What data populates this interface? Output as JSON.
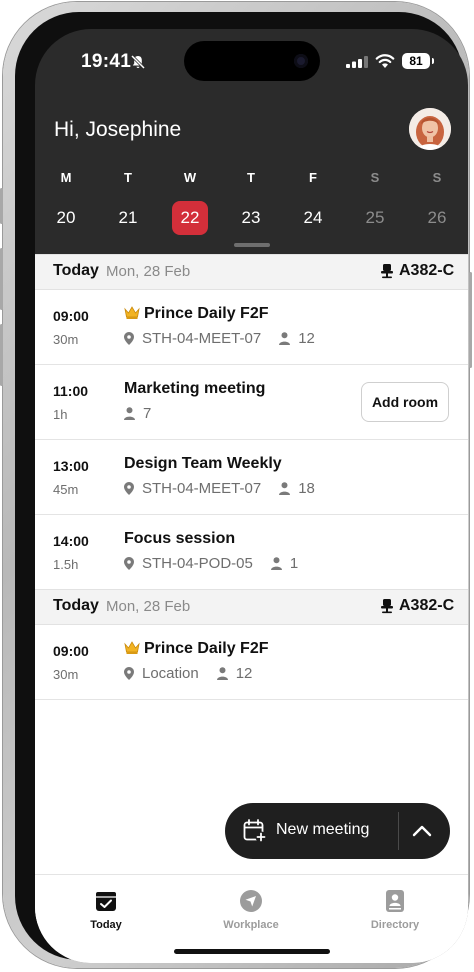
{
  "status_bar": {
    "time": "19:41",
    "battery": "81",
    "icons": [
      "bell-slash-icon",
      "signal-icon",
      "wifi-icon",
      "battery-icon"
    ]
  },
  "header": {
    "greeting": "Hi, Josephine",
    "avatar_icon": "avatar"
  },
  "week": [
    {
      "dow": "M",
      "num": "20",
      "state": "normal"
    },
    {
      "dow": "T",
      "num": "21",
      "state": "normal"
    },
    {
      "dow": "W",
      "num": "22",
      "state": "selected"
    },
    {
      "dow": "T",
      "num": "23",
      "state": "normal"
    },
    {
      "dow": "F",
      "num": "24",
      "state": "normal"
    },
    {
      "dow": "S",
      "num": "25",
      "state": "dim"
    },
    {
      "dow": "S",
      "num": "26",
      "state": "dim"
    }
  ],
  "sections": [
    {
      "label": "Today",
      "date": "Mon, 28 Feb",
      "desk": "A382-C",
      "items": [
        {
          "time": "09:00",
          "duration": "30m",
          "title": "Prince Daily F2F",
          "crown": true,
          "location": "STH-04-MEET-07",
          "attendees": "12"
        },
        {
          "time": "11:00",
          "duration": "1h",
          "title": "Marketing meeting",
          "crown": false,
          "location": "",
          "attendees": "7",
          "action": "Add room"
        },
        {
          "time": "13:00",
          "duration": "45m",
          "title": "Design Team Weekly",
          "crown": false,
          "location": "STH-04-MEET-07",
          "attendees": "18"
        },
        {
          "time": "14:00",
          "duration": "1.5h",
          "title": "Focus session",
          "crown": false,
          "location": "STH-04-POD-05",
          "attendees": "1"
        }
      ]
    },
    {
      "label": "Today",
      "date": "Mon, 28 Feb",
      "desk": "A382-C",
      "items": [
        {
          "time": "09:00",
          "duration": "30m",
          "title": "Prince Daily F2F",
          "crown": true,
          "location": "Location",
          "attendees": "12"
        }
      ]
    }
  ],
  "fab": {
    "label": "New meeting"
  },
  "tabs": [
    {
      "label": "Today",
      "icon": "calendar-check-icon",
      "active": true
    },
    {
      "label": "Workplace",
      "icon": "navigation-icon",
      "active": false
    },
    {
      "label": "Directory",
      "icon": "contact-book-icon",
      "active": false
    }
  ],
  "colors": {
    "accent": "#d32f3a",
    "header_bg": "#2b2b2b",
    "fab_bg": "#1f1f1f"
  }
}
